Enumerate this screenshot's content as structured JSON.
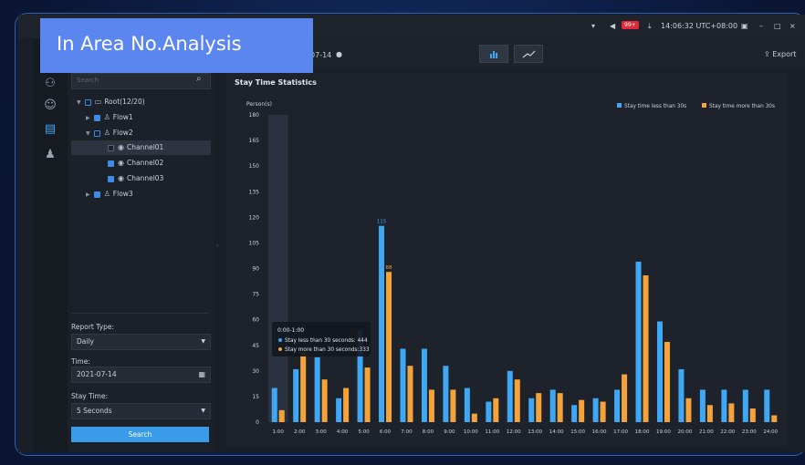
{
  "banner": {
    "title": "In Area No.Analysis"
  },
  "titlebar": {
    "badge": "99+",
    "time": "14:06:32 UTC+08:00"
  },
  "toolbar": {
    "date_fragment": "07-14",
    "export_label": "Export"
  },
  "sidebar_tree": {
    "search_placeholder": "Search",
    "nodes": [
      {
        "label": "Root(12/20)"
      },
      {
        "label": "Flow1"
      },
      {
        "label": "Flow2"
      },
      {
        "label": "Channel01"
      },
      {
        "label": "Channel02"
      },
      {
        "label": "Channel03"
      },
      {
        "label": "Flow3"
      }
    ]
  },
  "filters": {
    "report_type_label": "Report Type:",
    "report_type_value": "Daily",
    "time_label": "Time:",
    "time_value": "2021-07-14",
    "stay_time_label": "Stay Time:",
    "stay_time_value": "5 Seconds",
    "search_button": "Search"
  },
  "card": {
    "title": "Stay Time Statistics"
  },
  "colors": {
    "series_less": "#3ea8f5",
    "series_more": "#f3a33a",
    "accent": "#3a9be8",
    "banner": "#5b86f0"
  },
  "chart_data": {
    "type": "bar",
    "ylabel": "Person(s)",
    "ylim": [
      0,
      180
    ],
    "yticks": [
      0,
      15,
      30,
      45,
      60,
      75,
      90,
      105,
      120,
      135,
      150,
      165,
      180
    ],
    "categories": [
      "1:00",
      "2:00",
      "3:00",
      "4:00",
      "5:00",
      "6:00",
      "7:00",
      "8:00",
      "9:00",
      "10:00",
      "11:00",
      "12:00",
      "13:00",
      "14:00",
      "15:00",
      "16:00",
      "17:00",
      "18:00",
      "19:00",
      "20:00",
      "21:00",
      "22:00",
      "23:00",
      "24:00"
    ],
    "series": [
      {
        "name": "Stay time less than 30s",
        "values": [
          20,
          31,
          38,
          14,
          54,
          115,
          43,
          43,
          33,
          20,
          12,
          30,
          14,
          19,
          10,
          14,
          19,
          94,
          59,
          31,
          19,
          19,
          19,
          19
        ]
      },
      {
        "name": "Stay time more than 30s",
        "values": [
          7,
          41,
          25,
          20,
          32,
          88,
          33,
          19,
          19,
          5,
          14,
          25,
          17,
          17,
          13,
          12,
          28,
          86,
          47,
          14,
          10,
          11,
          8,
          4
        ]
      }
    ],
    "data_labels": [
      {
        "category": "6:00",
        "series": 0,
        "text": "115"
      },
      {
        "category": "6:00",
        "series": 1,
        "text": "88"
      }
    ],
    "legend_position": "top-right",
    "tooltip": {
      "title": "0:00-1:00",
      "lines": [
        "Stay less than 30 seconds: 444",
        "Stay more than 30 seconds:333"
      ]
    }
  }
}
